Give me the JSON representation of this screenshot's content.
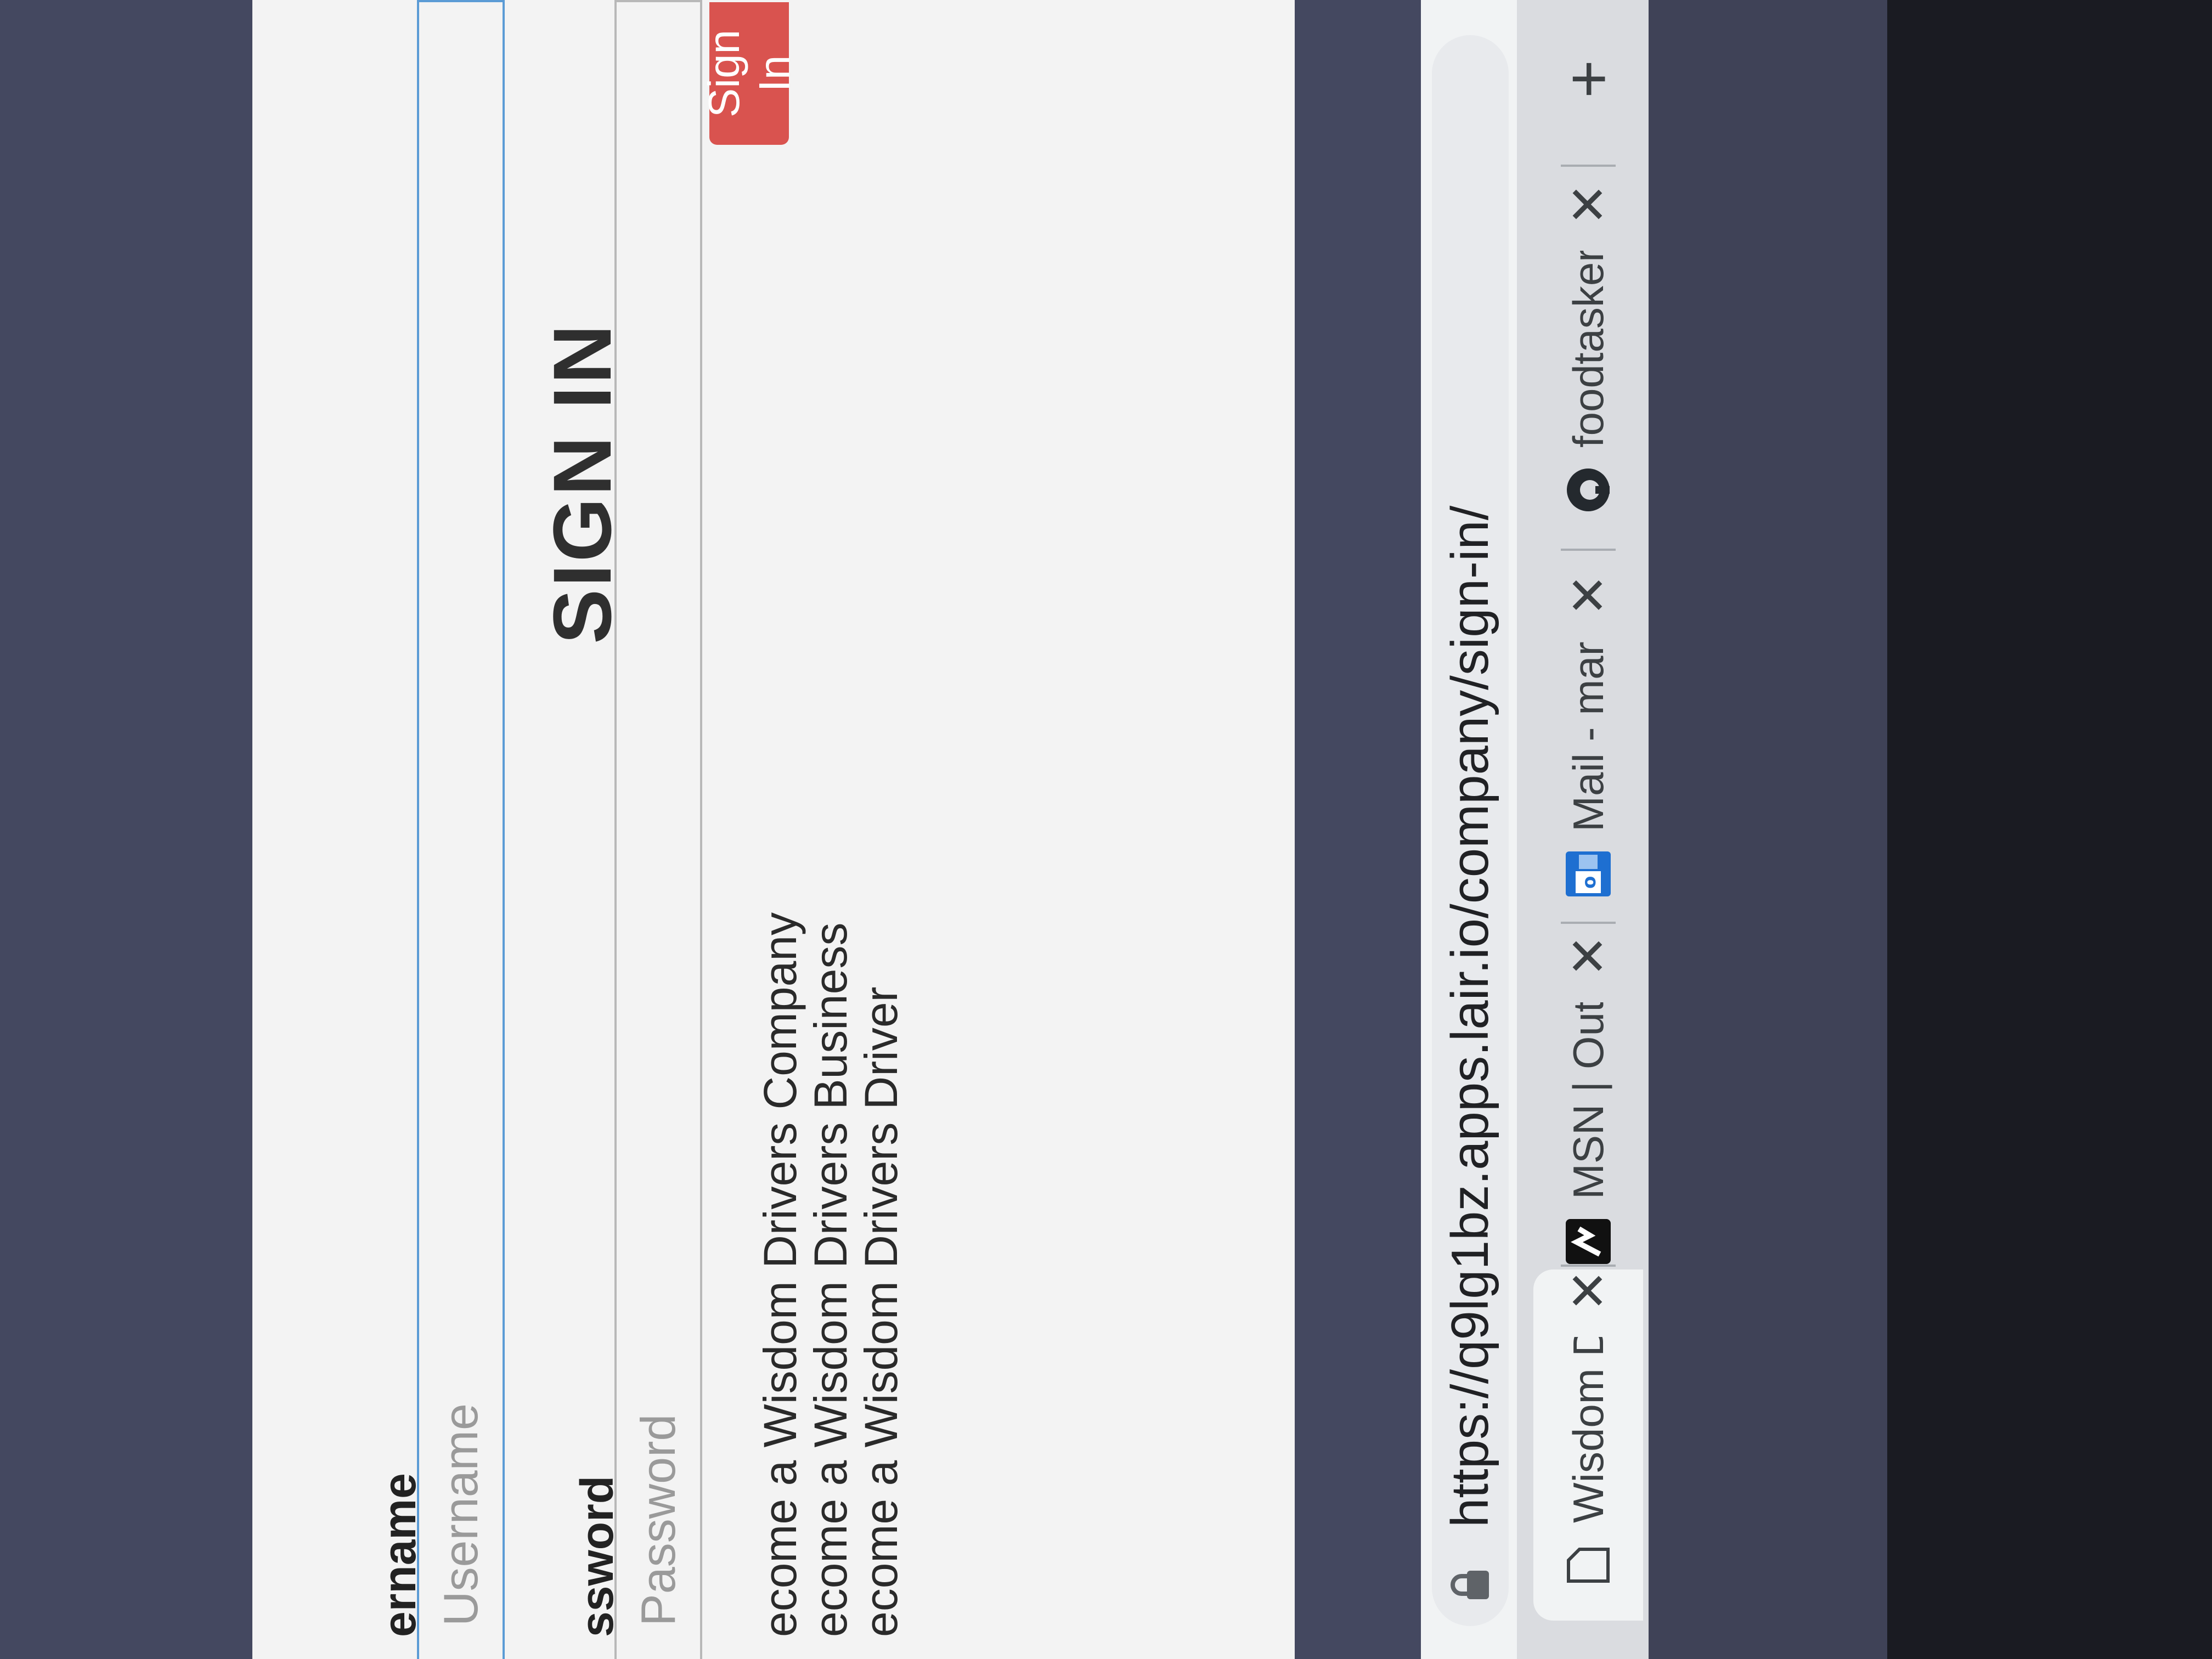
{
  "browser": {
    "tabs": [
      {
        "title": "Wisdom Dr",
        "icon": "page-icon",
        "active": true
      },
      {
        "title": "MSN | Outl",
        "icon": "msn-icon",
        "active": false
      },
      {
        "title": "Mail - mar",
        "icon": "outlook-icon",
        "active": false
      },
      {
        "title": "foodtasker",
        "icon": "github-icon",
        "active": false
      }
    ],
    "close_glyph": "✕",
    "new_tab_glyph": "+",
    "url": "https://q9lg1bz.apps.lair.io/company/sign-in/"
  },
  "page": {
    "title": "SIGN IN",
    "username_label": "ername",
    "username_placeholder": "Username",
    "password_label": "ssword",
    "password_placeholder": "Password",
    "sign_in_button": "Sign In",
    "links": [
      "ecome a Wisdom Drivers Company",
      "ecome a Wisdom Drivers Business",
      "ecome a Wisdom Drivers Driver"
    ],
    "accent_color": "#d9534f",
    "focus_color": "#5b9bd5"
  }
}
